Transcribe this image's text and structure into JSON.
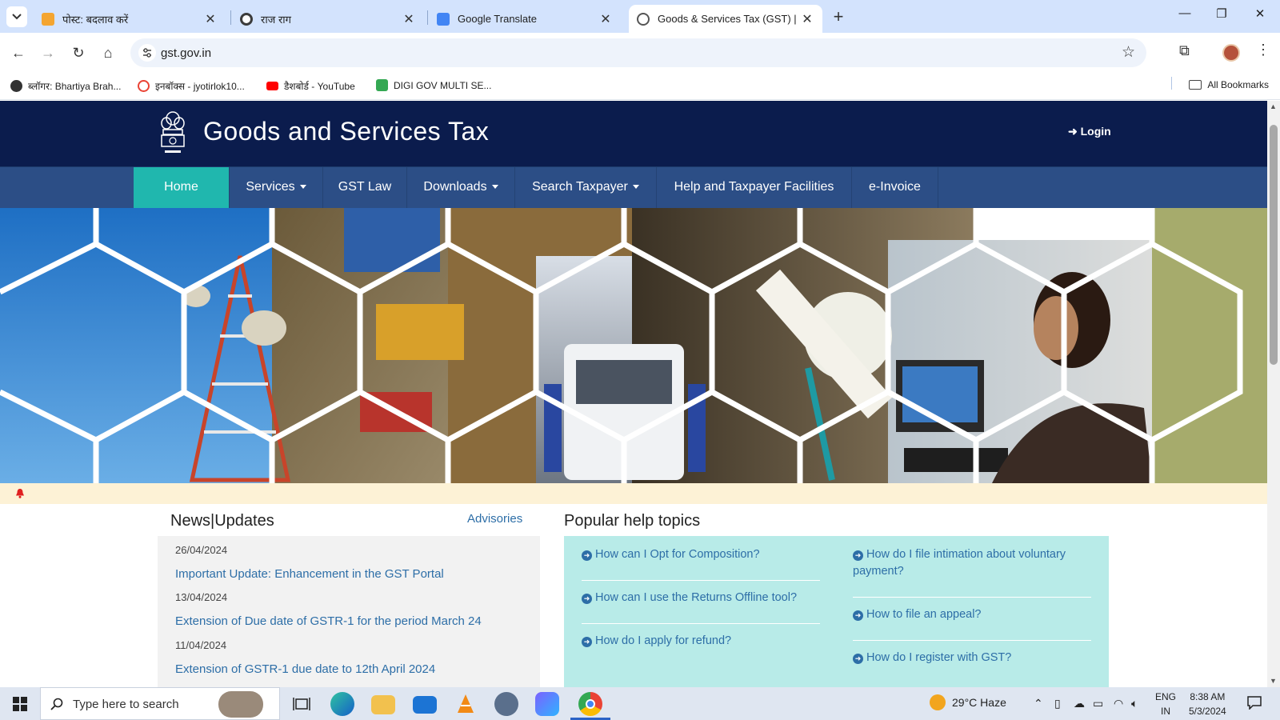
{
  "browser": {
    "tabs": [
      {
        "title": "पोस्ट: बदलाव करें",
        "favicon_color": "#f4a530",
        "close": "✕"
      },
      {
        "title": "राज राग",
        "favicon_color": "#3b3b3b",
        "close": "✕"
      },
      {
        "title": "Google Translate",
        "favicon_color": "#4285f4",
        "close": "✕"
      },
      {
        "title": "Goods & Services Tax (GST) | Hc",
        "favicon_color": "#555555",
        "close": "✕"
      }
    ],
    "new_tab": "+",
    "url": "gst.gov.in",
    "bookmarks": [
      {
        "label": "ब्लॉगर: Bhartiya Brah...",
        "icon_color": "#333333"
      },
      {
        "label": "इनबॉक्स - jyotirlok10...",
        "icon_color": "#ea4335"
      },
      {
        "label": "डैशबोर्ड - YouTube",
        "icon_color": "#ff0000"
      },
      {
        "label": "DIGI GOV MULTI SE...",
        "icon_color": "#34a853"
      }
    ],
    "all_bookmarks": "All Bookmarks"
  },
  "site": {
    "title": "Goods and Services Tax",
    "login": "Login",
    "nav": [
      {
        "label": "Home",
        "active": true
      },
      {
        "label": "Services",
        "dropdown": true
      },
      {
        "label": "GST Law"
      },
      {
        "label": "Downloads",
        "dropdown": true
      },
      {
        "label": "Search Taxpayer",
        "dropdown": true
      },
      {
        "label": "Help and Taxpayer Facilities"
      },
      {
        "label": "e-Invoice"
      }
    ],
    "accent": "#20b7ae",
    "header_color": "#0b1c4d"
  },
  "news": {
    "heading": "News|Updates",
    "advisories": "Advisories",
    "items": [
      {
        "date": "26/04/2024",
        "title": "Important Update: Enhancement in the GST Portal"
      },
      {
        "date": "13/04/2024",
        "title": "Extension of Due date of GSTR-1 for the period March 24"
      },
      {
        "date": "11/04/2024",
        "title": "Extension of GSTR-1 due date to 12th April 2024"
      }
    ]
  },
  "help": {
    "heading": "Popular help topics",
    "left": [
      "How can I Opt for Composition?",
      "How can I use the Returns Offline tool?",
      "How do I apply for refund?"
    ],
    "right": [
      "How do I file intimation about voluntary payment?",
      "How to file an appeal?",
      "How do I register with GST?"
    ]
  },
  "taskbar": {
    "search_placeholder": "Type here to search",
    "weather": "29°C  Haze",
    "lang_top": "ENG",
    "lang_bottom": "IN",
    "time": "8:38 AM",
    "date": "5/3/2024"
  }
}
